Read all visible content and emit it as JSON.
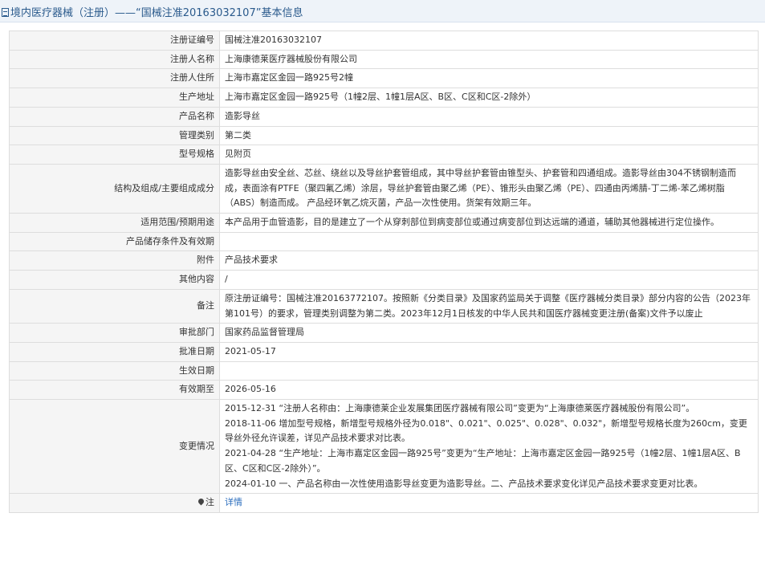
{
  "header": {
    "title": "境内医疗器械（注册）——“国械注准20163032107”基本信息"
  },
  "rows": [
    {
      "label": "注册证编号",
      "value": "国械注准20163032107"
    },
    {
      "label": "注册人名称",
      "value": "上海康德莱医疗器械股份有限公司"
    },
    {
      "label": "注册人住所",
      "value": "上海市嘉定区金园一路925号2幢"
    },
    {
      "label": "生产地址",
      "value": "上海市嘉定区金园一路925号（1幢2层、1幢1层A区、B区、C区和C区-2除外）"
    },
    {
      "label": "产品名称",
      "value": "造影导丝"
    },
    {
      "label": "管理类别",
      "value": "第二类"
    },
    {
      "label": "型号规格",
      "value": "见附页"
    },
    {
      "label": "结构及组成/主要组成成分",
      "value": "造影导丝由安全丝、芯丝、绕丝以及导丝护套管组成，其中导丝护套管由锥型头、护套管和四通组成。造影导丝由304不锈钢制造而成，表面涂有PTFE（聚四氟乙烯）涂层，导丝护套管由聚乙烯（PE）、锥形头由聚乙烯（PE）、四通由丙烯腈-丁二烯-苯乙烯树脂（ABS）制造而成。 产品经环氧乙烷灭菌，产品一次性使用。货架有效期三年。"
    },
    {
      "label": "适用范围/预期用途",
      "value": "本产品用于血管造影，目的是建立了一个从穿刺部位到病变部位或通过病变部位到达远端的通道，辅助其他器械进行定位操作。"
    },
    {
      "label": "产品储存条件及有效期",
      "value": ""
    },
    {
      "label": "附件",
      "value": "产品技术要求"
    },
    {
      "label": "其他内容",
      "value": "/"
    },
    {
      "label": "备注",
      "value": "原注册证编号：国械注准20163772107。按照新《分类目录》及国家药监局关于调整《医疗器械分类目录》部分内容的公告（2023年第101号）的要求，管理类别调整为第二类。2023年12月1日核发的中华人民共和国医疗器械变更注册(备案)文件予以废止"
    },
    {
      "label": "审批部门",
      "value": "国家药品监督管理局"
    },
    {
      "label": "批准日期",
      "value": "2021-05-17"
    },
    {
      "label": "生效日期",
      "value": ""
    },
    {
      "label": "有效期至",
      "value": "2026-05-16"
    }
  ],
  "changes": {
    "label": "变更情况",
    "entries": [
      "2015-12-31 “注册人名称由：上海康德莱企业发展集团医疗器械有限公司”变更为“上海康德莱医疗器械股份有限公司”。",
      "2018-11-06 增加型号规格，新增型号规格外径为0.018\"、0.021\"、0.025\"、0.028\"、0.032\"，新增型号规格长度为260cm，变更导丝外径允许误差，详见产品技术要求对比表。",
      "2021-04-28 “生产地址：上海市嘉定区金园一路925号”变更为“生产地址：上海市嘉定区金园一路925号（1幢2层、1幢1层A区、B区、C区和C区-2除外）”。",
      "2024-01-10 一、产品名称由一次性使用造影导丝变更为造影导丝。二、产品技术要求变化详见产品技术要求变更对比表。"
    ]
  },
  "note": {
    "label": "注",
    "link_text": "详情"
  }
}
